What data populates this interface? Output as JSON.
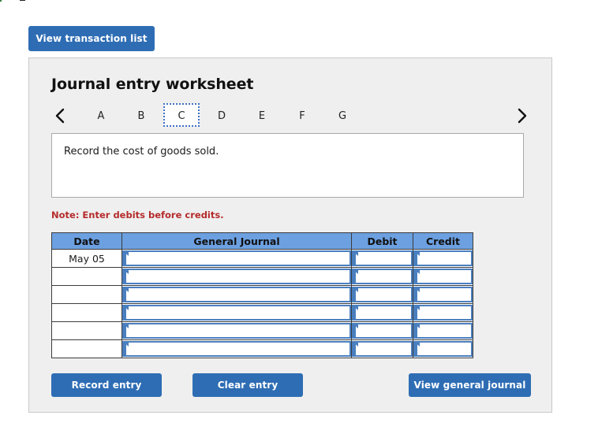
{
  "top_button": {
    "label": "View transaction list"
  },
  "panel": {
    "title": "Journal entry worksheet",
    "tabs": {
      "prev_icon": "chevron-left-icon",
      "next_icon": "chevron-right-icon",
      "items": [
        {
          "label": "A",
          "selected": false
        },
        {
          "label": "B",
          "selected": false
        },
        {
          "label": "C",
          "selected": true
        },
        {
          "label": "D",
          "selected": false
        },
        {
          "label": "E",
          "selected": false
        },
        {
          "label": "F",
          "selected": false
        },
        {
          "label": "G",
          "selected": false
        }
      ]
    },
    "instruction": "Record the cost of goods sold.",
    "note": "Note: Enter debits before credits.",
    "table": {
      "headers": [
        "Date",
        "General Journal",
        "Debit",
        "Credit"
      ],
      "rows": [
        {
          "date": "May 05",
          "general_journal": "",
          "debit": "",
          "credit": ""
        },
        {
          "date": "",
          "general_journal": "",
          "debit": "",
          "credit": ""
        },
        {
          "date": "",
          "general_journal": "",
          "debit": "",
          "credit": ""
        },
        {
          "date": "",
          "general_journal": "",
          "debit": "",
          "credit": ""
        },
        {
          "date": "",
          "general_journal": "",
          "debit": "",
          "credit": ""
        },
        {
          "date": "",
          "general_journal": "",
          "debit": "",
          "credit": ""
        }
      ]
    },
    "actions": {
      "record": "Record entry",
      "clear": "Clear entry",
      "view_journal": "View general journal"
    }
  },
  "colors": {
    "button_blue": "#2e6db4",
    "header_blue": "#6ca0e0",
    "field_border_blue": "#4a7fbf",
    "note_red": "#b52b2b",
    "panel_gray": "#efefef"
  }
}
